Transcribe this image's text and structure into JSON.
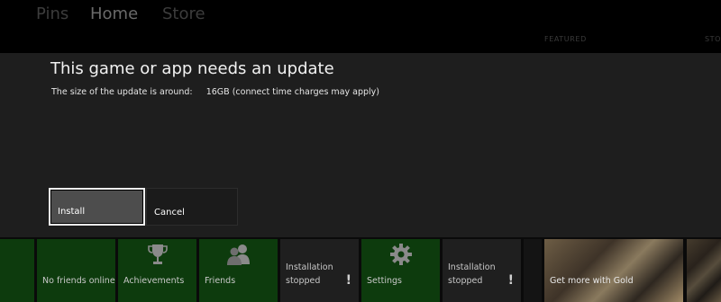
{
  "nav": {
    "tabs": [
      "Pins",
      "Home",
      "Store"
    ],
    "section_labels": [
      "FEATURED",
      "STO"
    ]
  },
  "dialog": {
    "title": "This game or app needs an update",
    "message": "The size of the update is around:     16GB (connect time charges may apply)",
    "install_label": "Install",
    "cancel_label": "Cancel"
  },
  "tiles": {
    "no_friends": "No friends online",
    "achievements": "Achievements",
    "friends": "Friends",
    "installation_stopped_1": "Installation\nstopped",
    "settings": "Settings",
    "installation_stopped_2": "Installation\nstopped",
    "gold": "Get more with Gold",
    "warning_mark": "!"
  },
  "icons": {
    "achievements": "trophy-icon",
    "friends": "friends-icon",
    "settings": "gear-icon"
  }
}
